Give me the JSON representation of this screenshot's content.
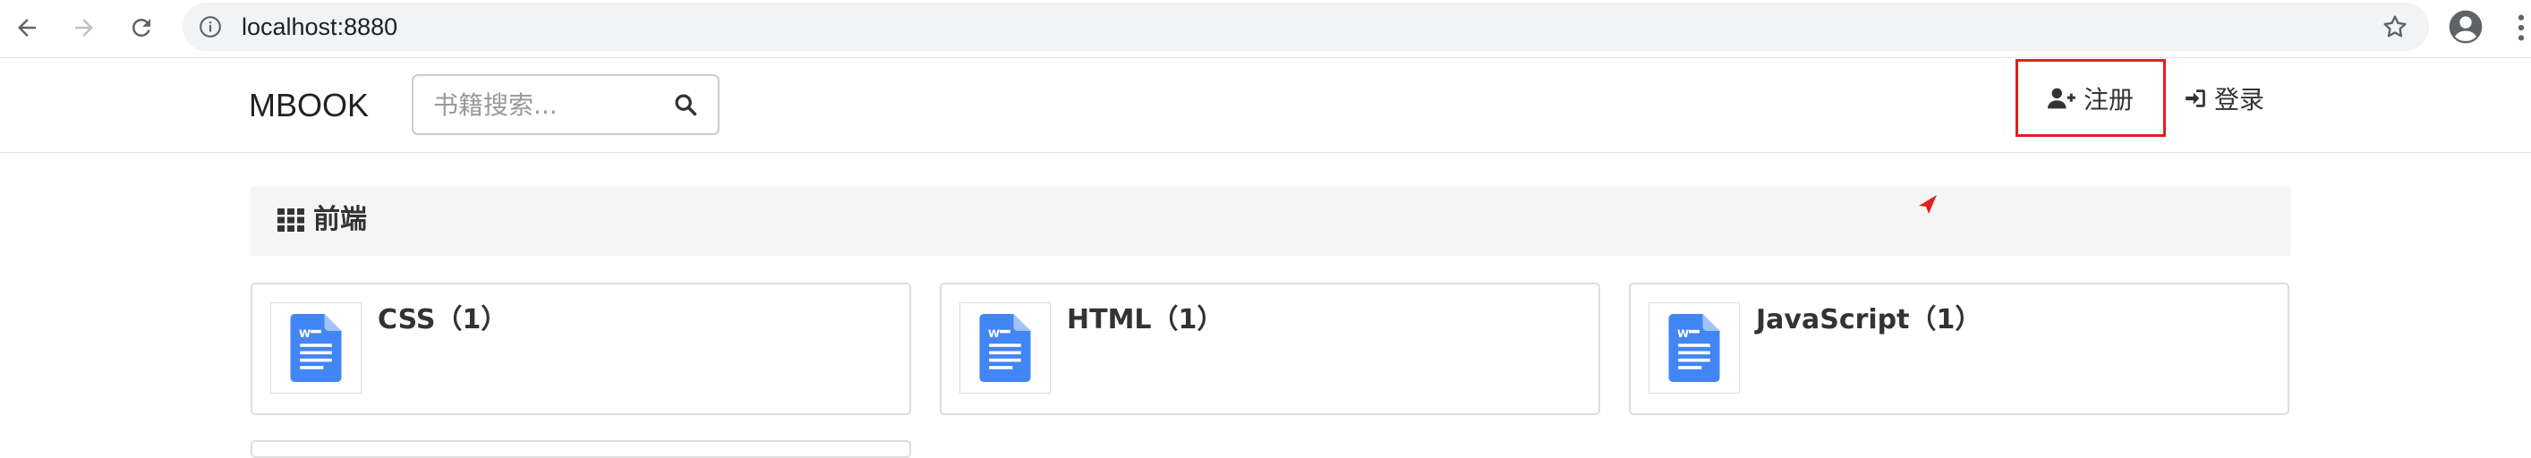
{
  "browser": {
    "url": "localhost:8880",
    "icons": {
      "back": "arrow-left-icon",
      "forward": "arrow-right-icon",
      "reload": "reload-icon",
      "info": "info-icon",
      "bookmark": "star-icon",
      "account": "account-icon",
      "menu": "kebab-icon"
    }
  },
  "header": {
    "brand": "MBOOK",
    "search": {
      "placeholder": "书籍搜索...",
      "value": ""
    },
    "register_label": "注册",
    "login_label": "登录"
  },
  "category": {
    "title": "前端"
  },
  "books": [
    {
      "title": "CSS（1）"
    },
    {
      "title": "HTML（1）"
    },
    {
      "title": "JavaScript（1）"
    }
  ],
  "colors": {
    "highlight_border": "#e02020",
    "doc_icon_blue": "#4285f4",
    "category_bg": "#f5f5f5"
  }
}
